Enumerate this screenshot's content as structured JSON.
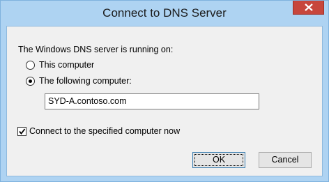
{
  "window": {
    "title": "Connect to DNS Server"
  },
  "dialog": {
    "prompt": "The Windows DNS server is running on:",
    "options": [
      {
        "label": "This computer",
        "selected": false
      },
      {
        "label": "The following computer:",
        "selected": true
      }
    ],
    "computer_name_value": "SYD-A.contoso.com",
    "connect_now_label": "Connect to the specified computer now",
    "connect_now_checked": true
  },
  "buttons": {
    "ok_label": "OK",
    "cancel_label": "Cancel"
  },
  "icons": {
    "close": "close-icon",
    "checkmark": "checkmark-icon"
  },
  "colors": {
    "titlebar": "#aed3f2",
    "close_button": "#c7463c",
    "client_background": "#f0f0f0"
  }
}
